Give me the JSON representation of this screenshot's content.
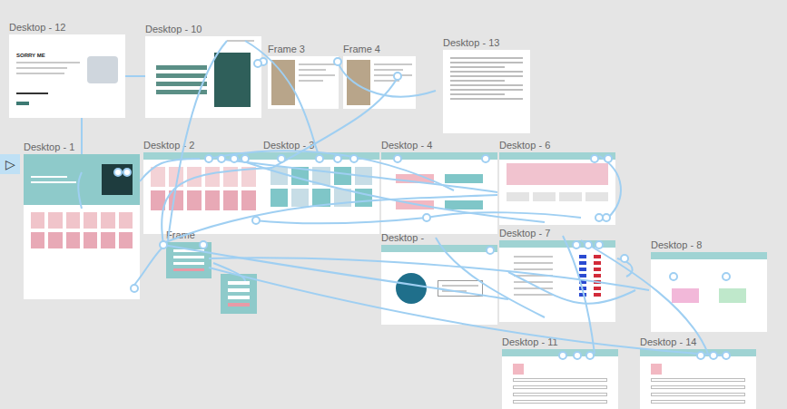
{
  "canvas": {
    "play_button": "▷"
  },
  "frames": [
    {
      "name": "Desktop - 12",
      "kind": "intro",
      "texts": [
        "SORRY ME"
      ]
    },
    {
      "name": "Desktop - 10",
      "kind": "contact",
      "texts": []
    },
    {
      "name": "Frame 3",
      "kind": "photo",
      "texts": []
    },
    {
      "name": "Frame 4",
      "kind": "photo",
      "texts": []
    },
    {
      "name": "Desktop - 13",
      "kind": "doc",
      "texts": []
    },
    {
      "name": "Desktop - 1",
      "kind": "home",
      "texts": []
    },
    {
      "name": "Desktop - 2",
      "kind": "books",
      "texts": []
    },
    {
      "name": "Desktop - 3",
      "kind": "tiles",
      "texts": []
    },
    {
      "name": "Desktop - 4",
      "kind": "buttons",
      "texts": []
    },
    {
      "name": "Desktop - 6",
      "kind": "banner",
      "texts": []
    },
    {
      "name": "Frame",
      "kind": "login",
      "texts": []
    },
    {
      "name": "",
      "kind": "popup",
      "texts": []
    },
    {
      "name": "Desktop - ",
      "kind": "profile",
      "texts": []
    },
    {
      "name": "Desktop - 7",
      "kind": "list",
      "texts": []
    },
    {
      "name": "Desktop - 8",
      "kind": "choice",
      "texts": []
    },
    {
      "name": "Desktop - 11",
      "kind": "form",
      "texts": []
    },
    {
      "name": "Desktop - 14",
      "kind": "form",
      "texts": []
    }
  ]
}
